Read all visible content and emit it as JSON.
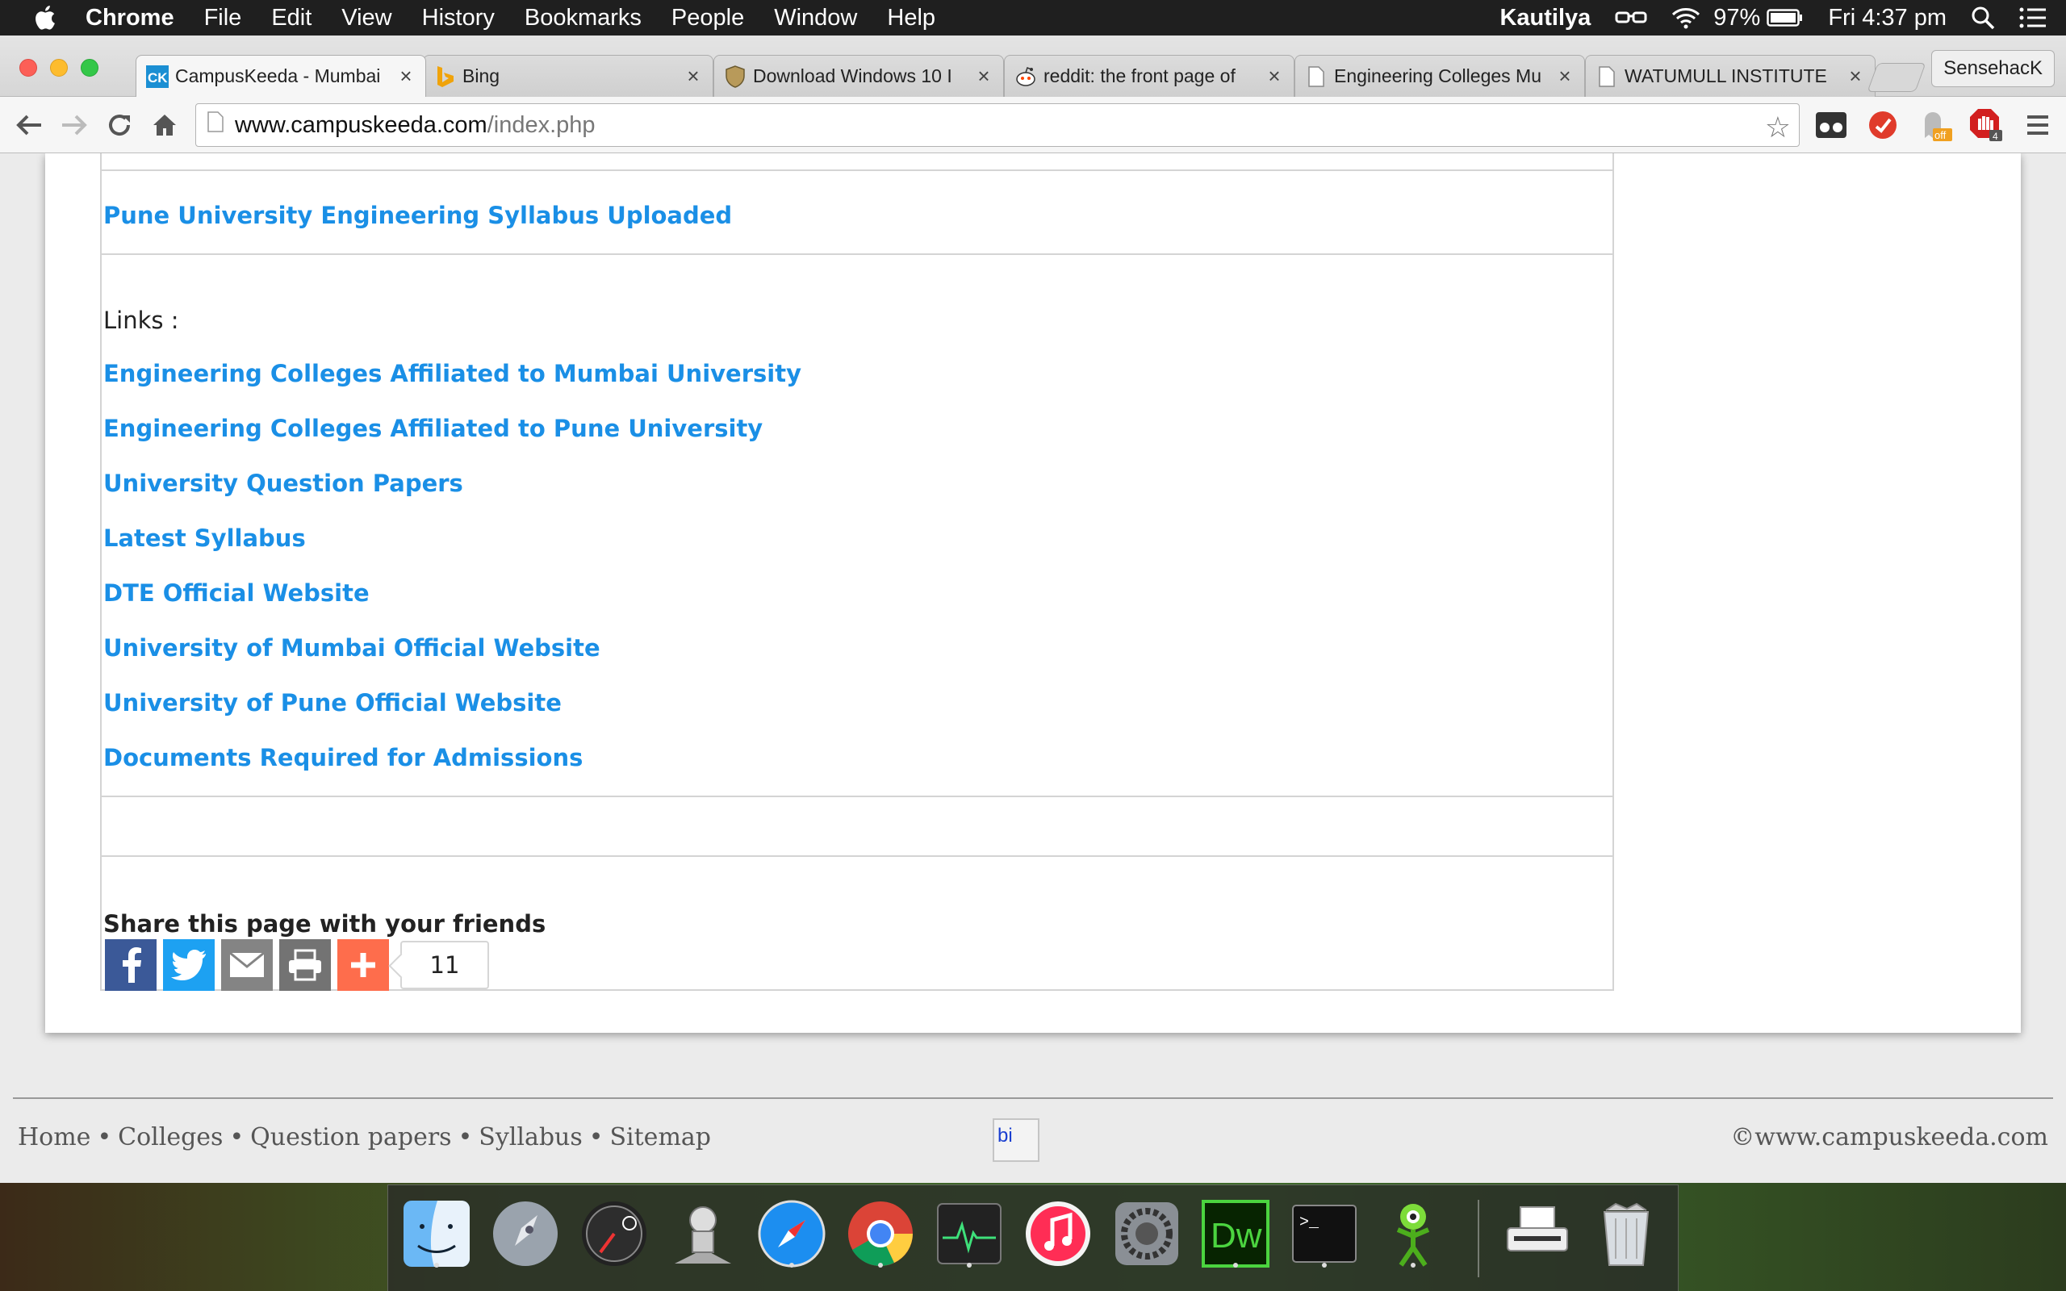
{
  "menubar": {
    "app_name": "Chrome",
    "menus": [
      "File",
      "Edit",
      "View",
      "History",
      "Bookmarks",
      "People",
      "Window",
      "Help"
    ],
    "user": "Kautilya",
    "battery": "97%",
    "clock": "Fri 4:37 pm"
  },
  "tabs": [
    {
      "title": "CampusKeeda - Mumbai",
      "favicon": "campuskeeda-icon",
      "active": true
    },
    {
      "title": "Bing",
      "favicon": "bing-icon",
      "active": false
    },
    {
      "title": "Download Windows 10 I",
      "favicon": "shield-icon",
      "active": false
    },
    {
      "title": "reddit: the front page of",
      "favicon": "reddit-icon",
      "active": false
    },
    {
      "title": "Engineering Colleges Mu",
      "favicon": "page-icon",
      "active": false
    },
    {
      "title": "WATUMULL INSTITUTE",
      "favicon": "page-icon",
      "active": false
    }
  ],
  "profile_name": "SensehacK",
  "omnibox": {
    "host": "www.campuskeeda.com",
    "path": "/index.php"
  },
  "page": {
    "syllabus_link": "Pune University Engineering Syllabus Uploaded",
    "links_label": "Links :",
    "links": [
      "Engineering Colleges Affiliated to Mumbai University",
      "Engineering Colleges Affiliated to Pune University",
      "University Question Papers",
      "Latest Syllabus",
      "DTE Official Website",
      "University of Mumbai Official Website",
      "University of Pune Official Website",
      "Documents Required for Admissions"
    ],
    "share_heading": "Share this page with your friends",
    "share_count": "11"
  },
  "footer": {
    "nav": [
      "Home",
      "Colleges",
      "Question papers",
      "Syllabus",
      "Sitemap"
    ],
    "image_alt": "bi",
    "copyright": "©www.campuskeeda.com"
  },
  "colors": {
    "link": "#1a8fe6",
    "facebook": "#3b5998",
    "twitter": "#1da1f2",
    "email": "#848484",
    "print": "#737373",
    "addthis": "#fe6d4c"
  },
  "dock": [
    "finder-icon",
    "launchpad-icon",
    "dashboard-icon",
    "automator-icon",
    "safari-icon",
    "chrome-icon",
    "activity-monitor-icon",
    "itunes-icon",
    "system-preferences-icon",
    "dreamweaver-icon",
    "terminal-icon",
    "alien-app-icon",
    "printer-icon",
    "trash-icon"
  ]
}
